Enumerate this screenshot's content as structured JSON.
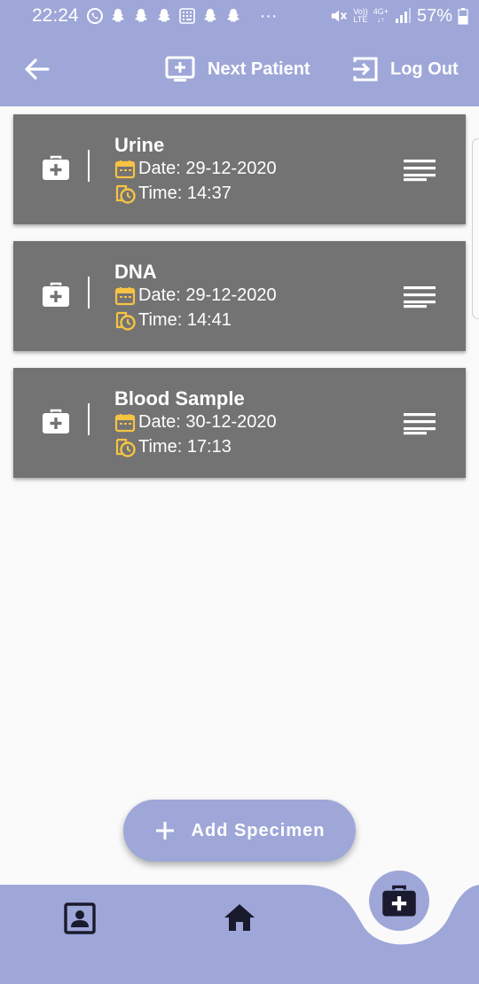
{
  "status_bar": {
    "time": "22:24",
    "dots": "···",
    "volte_top": "Vo))",
    "volte_bottom": "LTE",
    "network": "4G+",
    "battery": "57%"
  },
  "app_bar": {
    "next_patient_label": "Next Patient",
    "log_out_label": "Log Out"
  },
  "specimens": [
    {
      "name": "Urine",
      "date": "Date: 29-12-2020",
      "time": "Time: 14:37"
    },
    {
      "name": "DNA",
      "date": "Date: 29-12-2020",
      "time": "Time: 14:41"
    },
    {
      "name": "Blood Sample",
      "date": "Date: 30-12-2020",
      "time": "Time: 17:13"
    }
  ],
  "fab": {
    "label": "Add Specimen"
  },
  "colors": {
    "primary": "#9ea7d8",
    "card": "#737373",
    "accent_yellow": "#f6c343",
    "background": "#fafafa",
    "nav_icon": "#1a1a2e"
  },
  "bottom_nav": {
    "items": [
      "contact-icon",
      "home-icon",
      "medical-kit-icon"
    ],
    "active": "medical-kit-icon"
  }
}
